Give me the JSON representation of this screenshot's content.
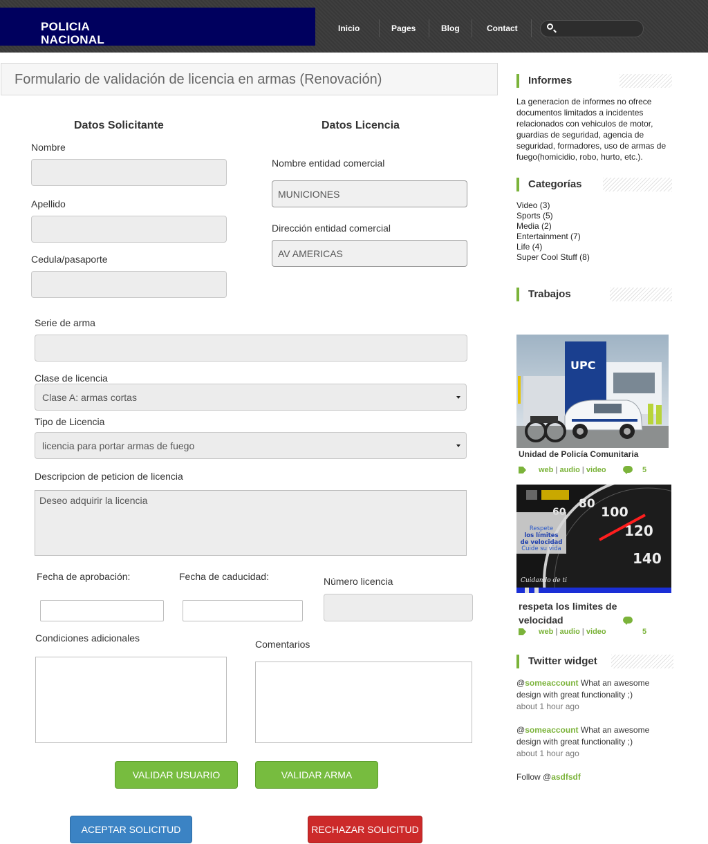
{
  "header": {
    "logo_line1": "POLICIA",
    "logo_line2": "NACIONAL",
    "nav": [
      "Inicio",
      "Pages",
      "Blog",
      "Contact"
    ],
    "search_placeholder": ""
  },
  "form": {
    "title": "Formulario  de validación de licencia en armas (Renovación)",
    "section_applicant": "Datos Solicitante",
    "section_license": "Datos Licencia",
    "label_nombre": "Nombre",
    "label_apellido": "Apellido",
    "label_cedula": "Cedula/pasaporte",
    "label_entidad": "Nombre entidad comercial",
    "value_entidad": "MUNICIONES",
    "label_direccion": "Dirección entidad comercial",
    "value_direccion": "AV AMERICAS",
    "label_serie": "Serie de arma",
    "label_clase": "Clase de licencia",
    "value_clase": "Clase A: armas cortas",
    "label_tipo": "Tipo de Licencia",
    "value_tipo": "licencia para portar armas de fuego",
    "label_descripcion": "Descripcion de peticion de licencia",
    "value_descripcion": "Deseo adquirir la licencia",
    "label_fecha_aprob": "Fecha de aprobación:",
    "label_fecha_cad": "Fecha de caducidad:",
    "label_numero": "Número licencia",
    "label_condiciones": "Condiciones adicionales",
    "label_comentarios": "Comentarios",
    "btn_validar_usuario": "VALIDAR USUARIO",
    "btn_validar_arma": "VALIDAR ARMA",
    "btn_aceptar": "ACEPTAR SOLICITUD",
    "btn_rechazar": "RECHAZAR SOLICITUD"
  },
  "sidebar": {
    "informes_title": "Informes",
    "informes_text": "La generacion de informes no ofrece documentos limitados a incidentes relacionados con vehiculos de motor, guardias de seguridad, agencia de seguridad, formadores, uso de armas de fuego(homicidio, robo, hurto, etc.).",
    "categorias_title": "Categorías",
    "categorias": [
      "Video (3)",
      "Sports (5)",
      "Media (2)",
      "Entertainment (7)",
      "Life (4)",
      "Super Cool Stuff (8)"
    ],
    "trabajos_title": "Trabajos",
    "post1": {
      "caption": "Unidad de Policía Comunitaria",
      "tag1": "web",
      "tag2": "audio",
      "tag3": "video",
      "comments": "5",
      "photo_sign": "UPC"
    },
    "post2": {
      "caption": "respeta los limites de velocidad",
      "tag1": "web",
      "tag2": "audio",
      "tag3": "video",
      "comments": "5",
      "sign_line1": "Respete",
      "sign_line2": "los límites",
      "sign_line3": "de velocidad",
      "sign_line4": "Cuide su vida",
      "sign_footer": "Cuidando de ti"
    },
    "twitter_title": "Twitter widget",
    "tweets": [
      {
        "at": "@",
        "account": "someaccount",
        "text": " What an awesome design with great functionality ;)",
        "ago": "about 1 hour ago"
      },
      {
        "at": "@",
        "account": "someaccount",
        "text": " What an awesome design with great functionality ;)",
        "ago": "about 1 hour ago"
      }
    ],
    "follow_prefix": "Follow @",
    "follow_account": "asdfsdf"
  },
  "colors": {
    "accent_green": "#7bb33a",
    "logo_navy": "#00005e",
    "button_green": "#77bc3f",
    "button_blue": "#3b83c4",
    "button_red": "#cc2a2a"
  }
}
